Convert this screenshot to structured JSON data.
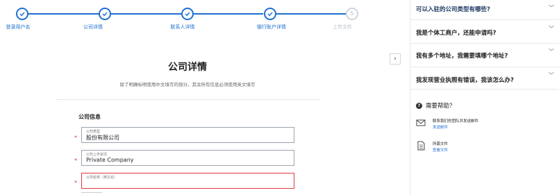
{
  "stepper": {
    "steps": [
      {
        "label": "登录用户名",
        "state": "done"
      },
      {
        "label": "公司详情",
        "state": "done"
      },
      {
        "label": "联系人详情",
        "state": "done"
      },
      {
        "label": "银行账户详情",
        "state": "done"
      },
      {
        "label": "上传文件",
        "state": "pending",
        "number": "5"
      }
    ]
  },
  "form": {
    "title": "公司详情",
    "subtitle": "除了明确标明使用中文填写的部分，其余所有信息必须使用英文填写",
    "section_label": "公司信息",
    "required_mark": "*",
    "fields": [
      {
        "label": "公司类型",
        "value": "股份有限公司"
      },
      {
        "label": "公司上市状况",
        "value": "Private Company"
      },
      {
        "label": "公司名称（英文名）",
        "value": ""
      }
    ]
  },
  "toggle": {
    "label": "›"
  },
  "faq": {
    "items": [
      {
        "question": "可以入驻的公司类型有哪些?"
      },
      {
        "question": "我是个体工商户，还能申请吗?"
      },
      {
        "question": "我有多个地址，我需要填哪个地址?"
      },
      {
        "question": "我发现营业执照有错误，我该怎么办?"
      }
    ],
    "chevron": "﹀"
  },
  "help": {
    "title": "需要帮助？",
    "icon": "?",
    "items": [
      {
        "icon": "mail-icon",
        "main": "联系我们的团队并发送邮件",
        "link": "发送邮件"
      },
      {
        "icon": "document-icon",
        "main": "所需文件",
        "link": "查看文件"
      }
    ]
  },
  "colors": {
    "accent": "#1f6fd0",
    "error": "#e0383e",
    "pending": "#cfd6de"
  }
}
